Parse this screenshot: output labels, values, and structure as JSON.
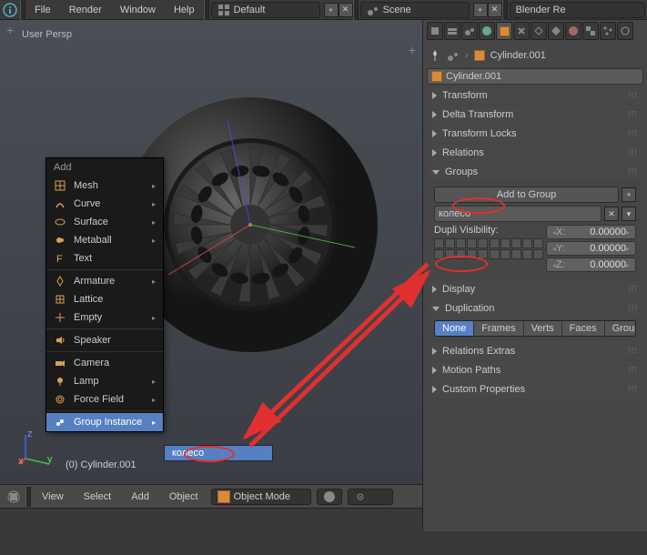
{
  "topbar": {
    "menus": [
      "File",
      "Render",
      "Window",
      "Help"
    ],
    "layout": "Default",
    "scene": "Scene",
    "engine": "Blender Re"
  },
  "viewport": {
    "persp": "User Persp",
    "object": "(0) Cylinder.001"
  },
  "vp_header": {
    "view": "View",
    "select": "Select",
    "add": "Add",
    "object": "Object",
    "mode": "Object Mode"
  },
  "add_menu": {
    "title": "Add",
    "mesh": "Mesh",
    "curve": "Curve",
    "surface": "Surface",
    "metaball": "Metaball",
    "text": "Text",
    "armature": "Armature",
    "lattice": "Lattice",
    "empty": "Empty",
    "speaker": "Speaker",
    "camera": "Camera",
    "lamp": "Lamp",
    "force": "Force Field",
    "group_instance": "Group Instance"
  },
  "submenu": {
    "item": "колесо"
  },
  "side": {
    "breadcrumb": "Cylinder.001",
    "name_field": "Cylinder.001",
    "panels": {
      "transform": "Transform",
      "delta": "Delta Transform",
      "locks": "Transform Locks",
      "relations": "Relations",
      "groups": "Groups",
      "display": "Display",
      "duplication": "Duplication",
      "rel_extras": "Relations Extras",
      "motion": "Motion Paths",
      "custom": "Custom Properties"
    },
    "groups": {
      "add_btn": "Add to Group",
      "name": "колесо",
      "dupli_label": "Dupli Visibility:",
      "x": {
        "lbl": "X:",
        "val": "0.00000"
      },
      "y": {
        "lbl": "Y:",
        "val": "0.00000"
      },
      "z": {
        "lbl": "Z:",
        "val": "0.00000"
      }
    },
    "dup_tabs": [
      "None",
      "Frames",
      "Verts",
      "Faces",
      "Group"
    ]
  }
}
